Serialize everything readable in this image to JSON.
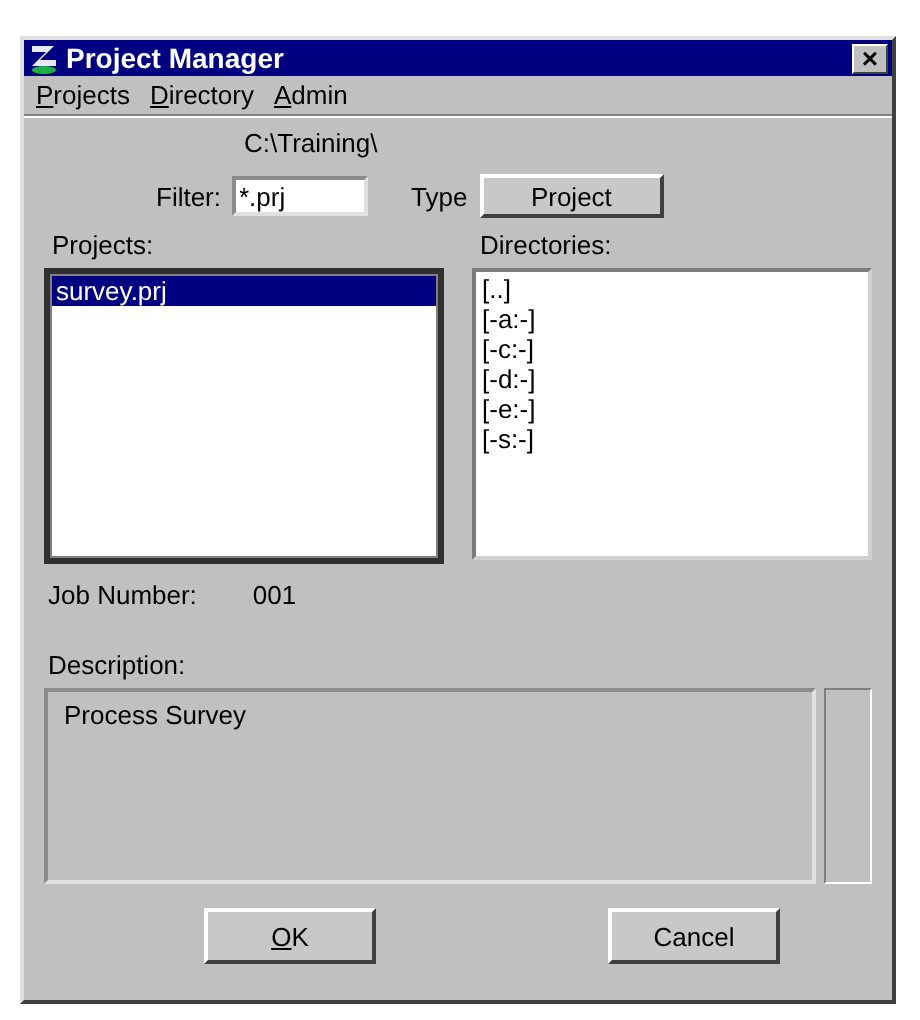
{
  "window": {
    "title": "Project Manager",
    "close": "×"
  },
  "menu": [
    {
      "label": "Projects",
      "mnemonic": true
    },
    {
      "label": "Directory",
      "mnemonic": true
    },
    {
      "label": "Admin",
      "mnemonic": true
    }
  ],
  "path": "C:\\Training\\",
  "filter": {
    "label": "Filter:",
    "value": "*.prj"
  },
  "type": {
    "label": "Type",
    "button": "Project"
  },
  "projects": {
    "label": "Projects:",
    "items": [
      {
        "label": "survey.prj",
        "selected": true
      }
    ]
  },
  "directories": {
    "label": "Directories:",
    "items": [
      {
        "label": "[..]",
        "selected": false
      },
      {
        "label": "[-a:-]",
        "selected": false
      },
      {
        "label": "[-c:-]",
        "selected": false
      },
      {
        "label": "[-d:-]",
        "selected": false
      },
      {
        "label": "[-e:-]",
        "selected": false
      },
      {
        "label": "[-s:-]",
        "selected": false
      }
    ]
  },
  "job_number": {
    "label": "Job Number:",
    "value": "001"
  },
  "description": {
    "label": "Description:",
    "value": "Process Survey"
  },
  "buttons": [
    {
      "label": "OK",
      "mnemonic": true
    },
    {
      "label": "Cancel",
      "mnemonic": false
    }
  ]
}
